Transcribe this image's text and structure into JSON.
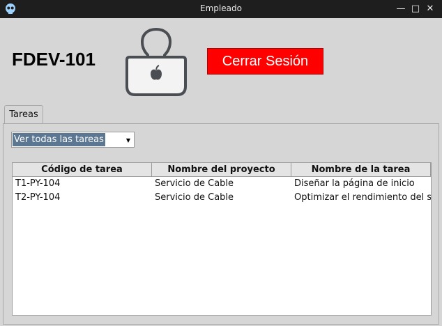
{
  "window": {
    "title": "Empleado"
  },
  "header": {
    "employee_id": "FDEV-101",
    "logout_label": "Cerrar Sesión"
  },
  "tabs": [
    {
      "label": "Tareas"
    }
  ],
  "filter": {
    "selected": "Ver todas las tareas"
  },
  "table": {
    "columns": [
      "Código de tarea",
      "Nombre del proyecto",
      "Nombre de la tarea"
    ],
    "rows": [
      [
        "T1-PY-104",
        "Servicio de Cable",
        "Diseñar la página de inicio"
      ],
      [
        "T2-PY-104",
        "Servicio de Cable",
        "Optimizar el rendimiento del s"
      ]
    ]
  },
  "colors": {
    "logout_bg": "#ff0000",
    "selection": "#5c7791",
    "titlebar": "#1e1e1e"
  },
  "icons": {
    "app": "skull-icon",
    "avatar": "user-laptop-icon",
    "minimize": "minimize-icon",
    "maximize": "maximize-icon",
    "close": "close-icon"
  }
}
